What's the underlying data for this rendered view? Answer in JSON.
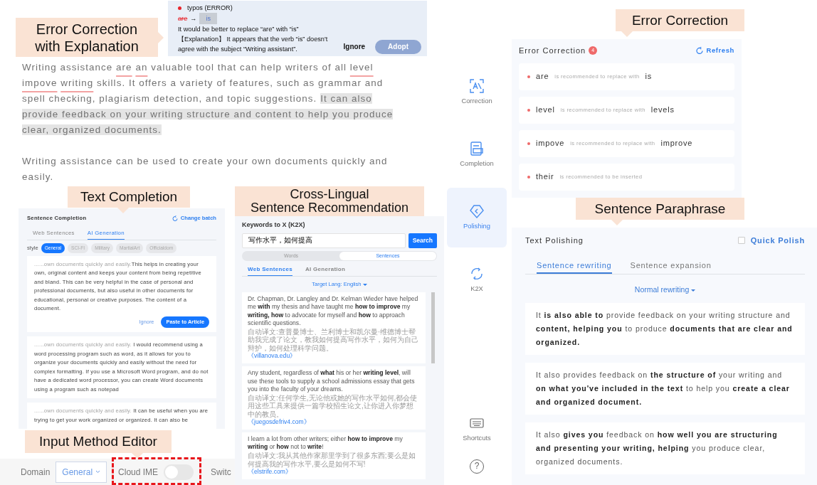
{
  "callouts": [
    {
      "lines": [
        "Error Correction",
        "with Explanation"
      ]
    },
    {
      "lines": [
        "Text Completion"
      ]
    },
    {
      "lines": [
        "Cross-Lingual",
        "Sentence Recommendation"
      ]
    },
    {
      "lines": [
        "Input Method Editor"
      ]
    },
    {
      "lines": [
        "Error Correction"
      ]
    },
    {
      "lines": [
        "Sentence Paraphrase"
      ]
    }
  ],
  "editor": {
    "paragraphs": [
      [
        {
          "kind": "text",
          "text": "Writing assistance"
        },
        {
          "kind": "error",
          "text": "are"
        },
        {
          "kind": "error",
          "text": "an"
        },
        {
          "kind": "text",
          "text": "valuable tool that can help writers of all"
        },
        {
          "kind": "error",
          "text": "level"
        },
        {
          "kind": "error",
          "text": "impove"
        },
        {
          "kind": "error",
          "text": "writing"
        },
        {
          "kind": "text",
          "text": "skills. It offers a variety of features, such as grammar and spell checking, plagiarism detection, and topic suggestions."
        },
        {
          "kind": "highlight",
          "text": "It can also provide feedback on your writing structure and content to help you produce clear, organized documents."
        }
      ],
      [
        {
          "kind": "text",
          "text": "Writing assistance can be used to create your own documents quickly and easily."
        }
      ]
    ]
  },
  "tooltip": {
    "category": "typos (ERROR)",
    "original": "are",
    "arrow": "→",
    "replacement": "is",
    "message": "It would be better to replace “are” with “is”",
    "explanation": "【Explanation】 It appears that the verb “is” doesn't agree with the subject “Writing assistant”.",
    "buttons": [
      {
        "label": "Ignore",
        "primary": false
      },
      {
        "label": "Adopt",
        "primary": true
      }
    ]
  },
  "sentence_completion": {
    "title": "Sentence Completion",
    "action": "Change batch",
    "tabs": [
      {
        "label": "Web Sentences",
        "selected": false
      },
      {
        "label": "AI Generation",
        "selected": true
      }
    ],
    "style_label": "style",
    "styles": [
      {
        "label": "General",
        "selected": true
      },
      {
        "label": "SCI-FI",
        "selected": false
      },
      {
        "label": "Military",
        "selected": false
      },
      {
        "label": "MartialArt",
        "selected": false
      },
      {
        "label": "Officialdom",
        "selected": false
      }
    ],
    "cards": [
      {
        "prefix": "......own documents quickly and easily.",
        "text": "This helps in creating your own, original content and keeps your content from being repetitive and bland. This can be very helpful in the case of personal and professional documents, but also useful in other documents for educational, personal or creative purposes. The content of a document.",
        "buttons": [
          {
            "label": "Ignore",
            "primary": false
          },
          {
            "label": "Paste to Article",
            "primary": true
          }
        ]
      },
      {
        "prefix": "......own documents quickly and easily.",
        "text": " I would recommend using a word processing program such as word, as it allows for you to organize your documents quickly and easily without the need for complex formatting. If you use a Microsoft Word program, and do not have a dedicated word processor, you can create Word documents using a program such as notepad"
      },
      {
        "prefix": "......own documents quickly and easily.",
        "text": " It can be useful when you are trying to get your work organized or organized. It can also be"
      }
    ]
  },
  "k2x": {
    "title": "Keywords to X (K2X)",
    "query": "写作水平，如何提高",
    "search": "Search",
    "modes": [
      {
        "label": "Words",
        "selected": false
      },
      {
        "label": "Sentences",
        "selected": true
      }
    ],
    "tabs": [
      {
        "label": "Web Sentences",
        "selected": true
      },
      {
        "label": "AI Generation",
        "selected": false
      }
    ],
    "target": "Target Lang: English",
    "results": [
      {
        "text": "Dr. Chapman, Dr. Langley and Dr. Kelman Wieder have helped me **with** my thesis and have taught me **how to improve** my **writing, how** to advocate for myself and **how** to approach scientific questions.",
        "translation": "自动译文:查普曼博士、兰利博士和凯尔曼·维德博士帮助我完成了论文，教我如何提高写作水平，如何为自己辩护，如何处理科学问题。",
        "source": "《villanova.edu》"
      },
      {
        "text": "Any student, regardless of **what** his or her **writing level**, will use these tools to supply a school admissions essay that gets you into the faculty of your dreams.",
        "translation": "自动译文:任何学生,无论他或她的写作水平如何,都会使用这些工具来提供一篇学校招生论文,让你进入你梦想中的教员。",
        "source": "《juegosdefriv4.com》"
      },
      {
        "text": "I learn a lot from other writers; either **how to improve** my **writing** or **how** not to **write**!",
        "translation": "自动译文:我从其他作家那里学到了很多东西;要么是如何提高我的写作水平,要么是如何不写!",
        "source": "《elstrife.com》"
      }
    ]
  },
  "ime_bar": {
    "domain_label": "Domain",
    "domain_value": "General",
    "cloud_ime_label": "Cloud IME",
    "cloud_ime_on": false,
    "next_label": "Switc"
  },
  "sidebar": {
    "items": [
      {
        "label": "Correction",
        "selected": false
      },
      {
        "label": "Completion",
        "selected": false
      },
      {
        "label": "Polishing",
        "selected": true
      },
      {
        "label": "K2X",
        "selected": false
      },
      {
        "label": "Shortcuts",
        "selected": false
      }
    ],
    "help": "?"
  },
  "error_correction": {
    "title": "Error Correction",
    "count": "4",
    "refresh": "Refresh",
    "items": [
      {
        "word": "are",
        "note": "is recommended to replace with",
        "replacement": "is"
      },
      {
        "word": "level",
        "note": "is recommended to replace with",
        "replacement": "levels"
      },
      {
        "word": "impove",
        "note": "is recommended to replace with",
        "replacement": "improve"
      },
      {
        "word": "their",
        "note": "is recommended to be inserted"
      }
    ]
  },
  "text_polishing": {
    "title": "Text Polishing",
    "quick_polish": "Quick Polish",
    "quick_polish_checked": false,
    "tabs": [
      {
        "label": "Sentence rewriting",
        "selected": true
      },
      {
        "label": "Sentence expansion",
        "selected": false
      }
    ],
    "mode": "Normal rewriting",
    "results": [
      "It **is also able to** provide feedback on your writing structure and **content, helping you** to produce **documents that are clear and organized.**",
      "It also provides feedback on **the structure of** your writing and **on what you've included in the text** to help you **create a clear and organized document.**",
      "It also **gives you** feedback on **how well you are structuring and presenting your writing, helping** you produce clear, organized documents."
    ]
  }
}
